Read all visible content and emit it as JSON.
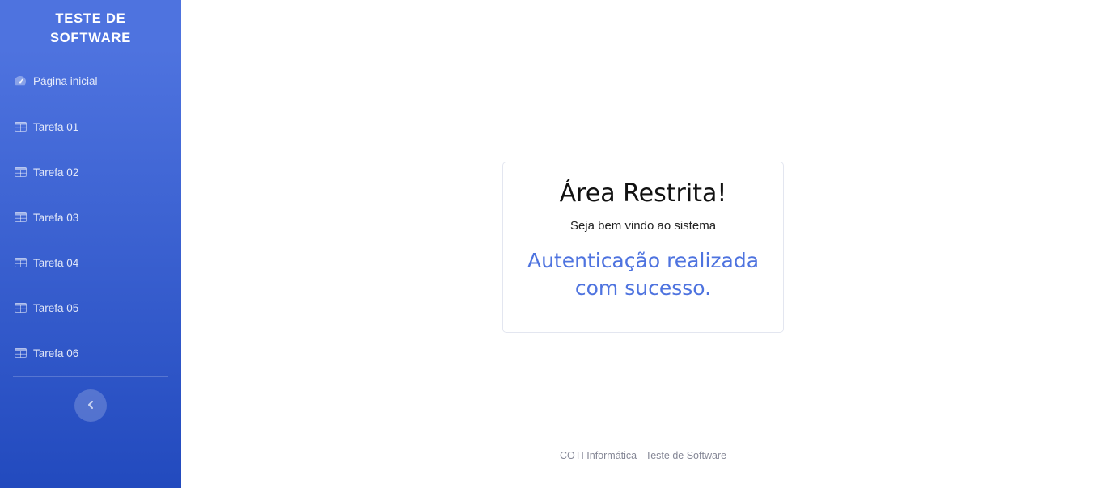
{
  "sidebar": {
    "brand_line1": "TESTE DE",
    "brand_line2": "SOFTWARE",
    "items": [
      {
        "label": "Página inicial",
        "icon": "tachometer-icon"
      },
      {
        "label": "Tarefa 01",
        "icon": "table-icon"
      },
      {
        "label": "Tarefa 02",
        "icon": "table-icon"
      },
      {
        "label": "Tarefa 03",
        "icon": "table-icon"
      },
      {
        "label": "Tarefa 04",
        "icon": "table-icon"
      },
      {
        "label": "Tarefa 05",
        "icon": "table-icon"
      },
      {
        "label": "Tarefa 06",
        "icon": "table-icon"
      }
    ],
    "toggle_icon": "chevron-left-icon"
  },
  "main": {
    "card": {
      "title": "Área Restrita!",
      "subtitle": "Seja bem vindo ao sistema",
      "message": "Autenticação realizada com sucesso."
    },
    "footer": "COTI Informática - Teste de Software"
  },
  "colors": {
    "sidebar_start": "#4e73df",
    "sidebar_end": "#224abe",
    "accent": "#4e73df"
  }
}
